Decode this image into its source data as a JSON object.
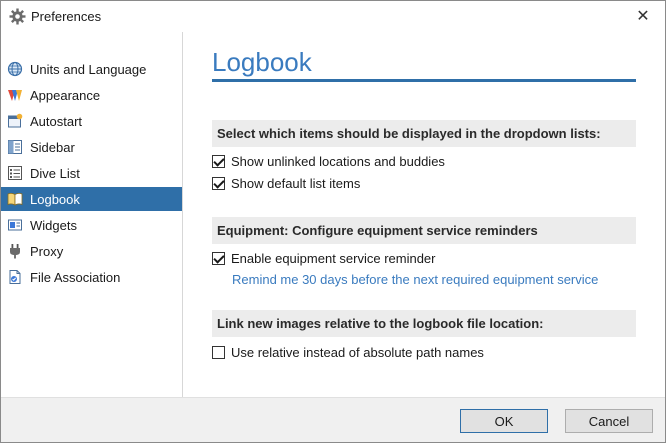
{
  "window": {
    "title": "Preferences",
    "close_glyph": "✕"
  },
  "sidebar": {
    "items": [
      {
        "label": "Units and Language",
        "icon": "globe-icon",
        "selected": false
      },
      {
        "label": "Appearance",
        "icon": "palette-icon",
        "selected": false
      },
      {
        "label": "Autostart",
        "icon": "autostart-icon",
        "selected": false
      },
      {
        "label": "Sidebar",
        "icon": "sidebar-panel-icon",
        "selected": false
      },
      {
        "label": "Dive List",
        "icon": "list-icon",
        "selected": false
      },
      {
        "label": "Logbook",
        "icon": "book-icon",
        "selected": true
      },
      {
        "label": "Widgets",
        "icon": "widgets-icon",
        "selected": false
      },
      {
        "label": "Proxy",
        "icon": "plug-icon",
        "selected": false
      },
      {
        "label": "File Association",
        "icon": "file-association-icon",
        "selected": false
      }
    ]
  },
  "main": {
    "title": "Logbook",
    "sections": {
      "dropdown": {
        "header": "Select which items should be displayed in the dropdown lists:",
        "options": [
          {
            "label": "Show unlinked locations and buddies",
            "checked": true
          },
          {
            "label": "Show default list items",
            "checked": true
          }
        ]
      },
      "equipment": {
        "header": "Equipment: Configure equipment service reminders",
        "option": {
          "label": "Enable equipment service reminder",
          "checked": true
        },
        "reminder_link": "Remind me 30 days before the next required equipment service"
      },
      "images": {
        "header": "Link new images relative to the logbook file location:",
        "option": {
          "label": "Use relative instead of absolute path names",
          "checked": false
        }
      }
    }
  },
  "footer": {
    "ok_label": "OK",
    "cancel_label": "Cancel"
  },
  "colors": {
    "accent": "#2f6fa8",
    "title_blue": "#3a7bbf",
    "section_bg": "#ececec"
  }
}
